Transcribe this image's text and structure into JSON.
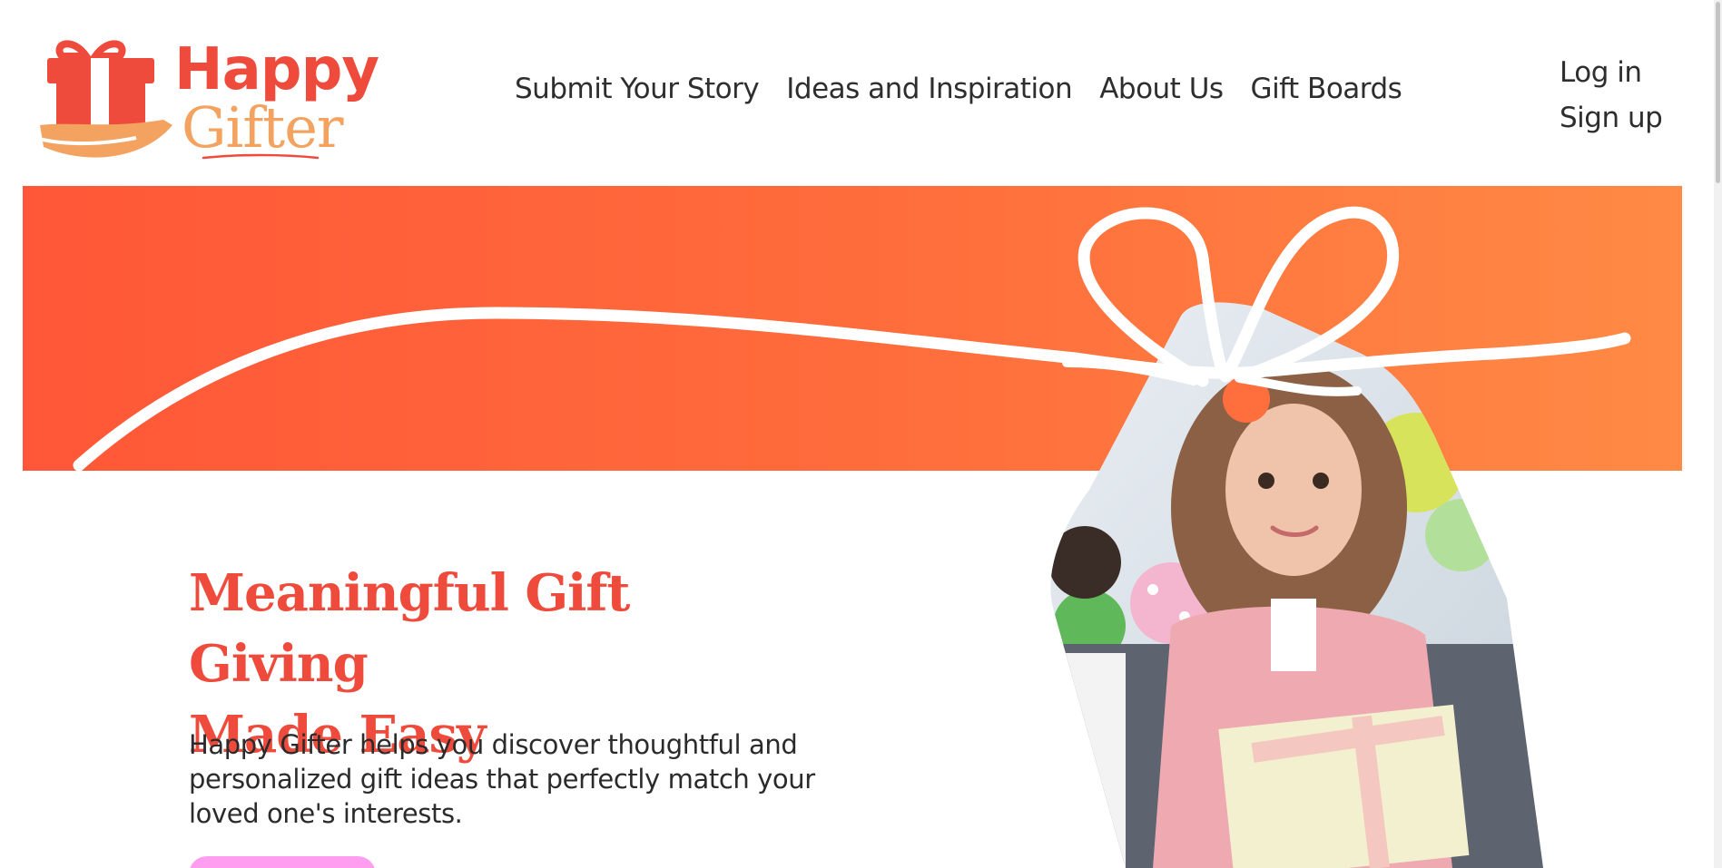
{
  "brand": {
    "line1": "Happy",
    "line2": "Gifter",
    "primary_color": "#ee4b3c",
    "secondary_color": "#f3a35f"
  },
  "nav": {
    "items": [
      {
        "label": "Submit Your Story"
      },
      {
        "label": "Ideas and Inspiration"
      },
      {
        "label": "About Us"
      },
      {
        "label": "Gift Boards"
      }
    ]
  },
  "auth": {
    "login": "Log in",
    "signup": "Sign up"
  },
  "banner": {
    "gradient_start": "#ff5738",
    "gradient_end": "#ff8a45",
    "ribbon": "white-ribbon-bow"
  },
  "hero": {
    "title_line1": "Meaningful Gift Giving",
    "title_line2": "Made Easy",
    "description": "Happy Gifter helps you discover thoughtful and personalized gift ideas that perfectly match your loved one's interests.",
    "cta_color": "#ff9ef0",
    "image": "gift-tag-photo-girl-with-present"
  }
}
